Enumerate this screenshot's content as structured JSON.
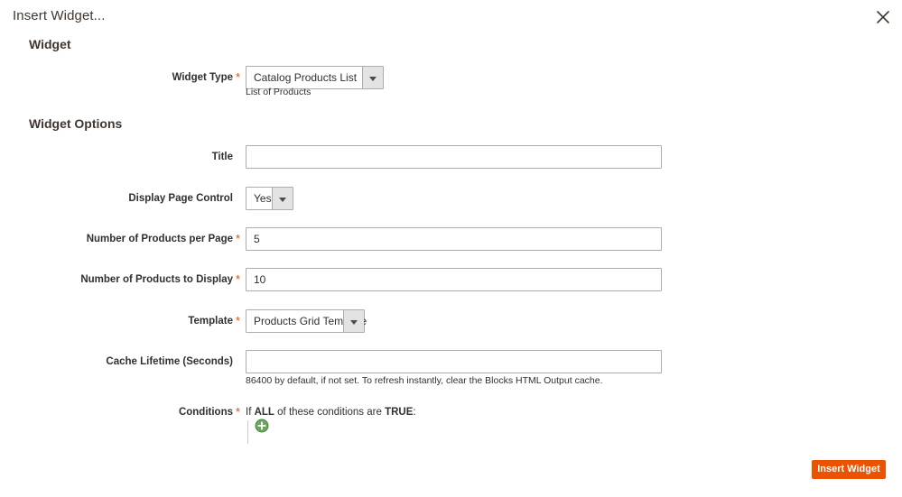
{
  "modal": {
    "title": "Insert Widget...",
    "close_icon": "close-icon"
  },
  "sections": {
    "widget": "Widget",
    "widget_options": "Widget Options"
  },
  "widget": {
    "type": {
      "label": "Widget Type",
      "required": "*",
      "value": "Catalog Products List",
      "note": "List of Products"
    }
  },
  "options": {
    "title": {
      "label": "Title",
      "value": "",
      "placeholder": ""
    },
    "display_page_control": {
      "label": "Display Page Control",
      "value": "Yes"
    },
    "products_per_page": {
      "label": "Number of Products per Page",
      "required": "*",
      "value": "5"
    },
    "products_to_display": {
      "label": "Number of Products to Display",
      "required": "*",
      "value": "10"
    },
    "template": {
      "label": "Template",
      "required": "*",
      "value": "Products Grid Template"
    },
    "cache_lifetime": {
      "label": "Cache Lifetime (Seconds)",
      "value": "",
      "placeholder": "",
      "note": "86400 by default, if not set. To refresh instantly, clear the Blocks HTML Output cache."
    },
    "conditions": {
      "label": "Conditions",
      "required": "*",
      "prefix": "If",
      "aggregator": "ALL",
      "middle": "of these conditions are",
      "truth": "TRUE",
      "suffix": ":",
      "add_icon": "add-circle-icon"
    }
  },
  "footer": {
    "insert_label": "Insert Widget"
  },
  "colors": {
    "accent": "#eb5202",
    "required": "#e04f00",
    "add_green": "#5a9e52",
    "border": "#adadad"
  }
}
